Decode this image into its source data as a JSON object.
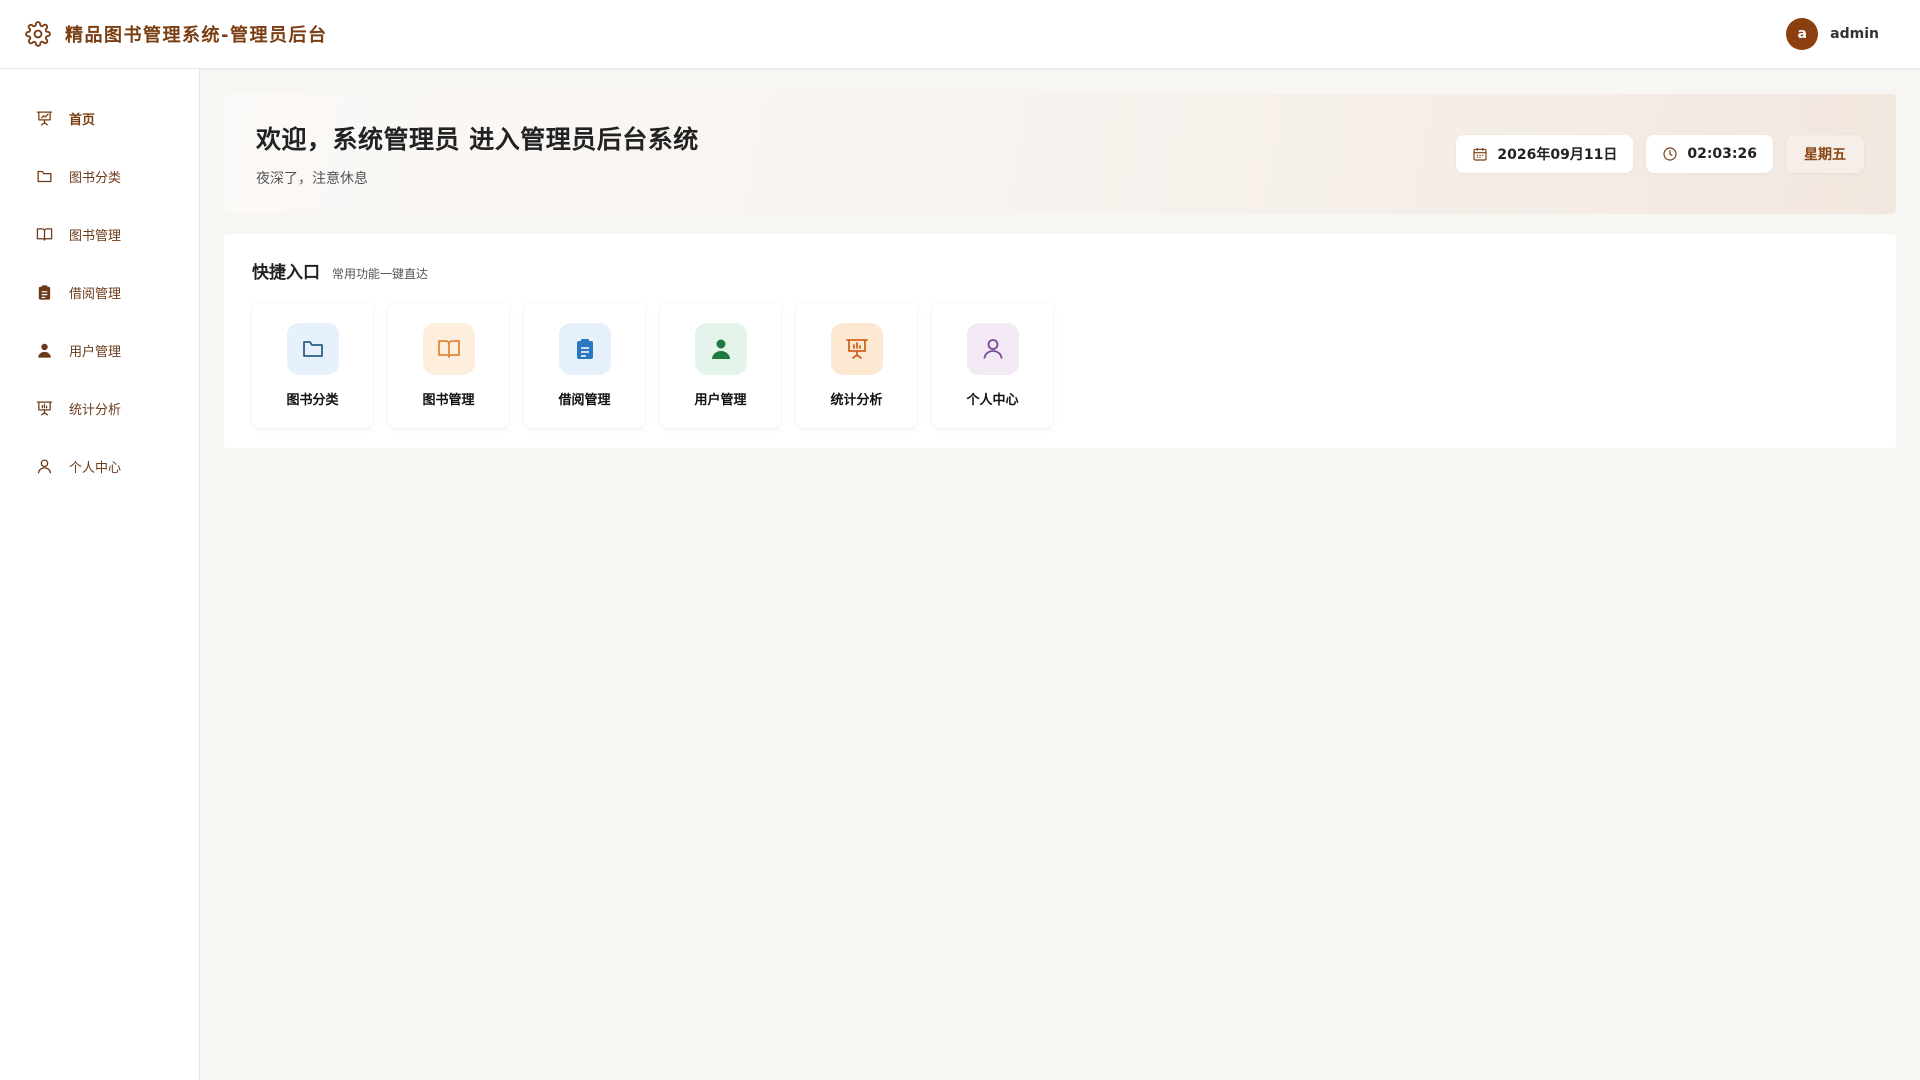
{
  "header": {
    "title": "精品图书管理系统-管理员后台",
    "avatar_letter": "a",
    "username": "admin"
  },
  "sidebar": {
    "items": [
      {
        "label": "首页",
        "icon": "presentation-icon",
        "active": true
      },
      {
        "label": "图书分类",
        "icon": "folder-icon"
      },
      {
        "label": "图书管理",
        "icon": "book-open-icon"
      },
      {
        "label": "借阅管理",
        "icon": "clipboard-icon"
      },
      {
        "label": "用户管理",
        "icon": "user-solid-icon"
      },
      {
        "label": "统计分析",
        "icon": "chart-board-icon"
      },
      {
        "label": "个人中心",
        "icon": "user-outline-icon"
      }
    ]
  },
  "welcome": {
    "title": "欢迎，系统管理员 进入管理员后台系统",
    "subtitle": "夜深了，注意休息",
    "date": "2026年09月11日",
    "time": "02:03:26",
    "weekday": "星期五"
  },
  "quick": {
    "title": "快捷入口",
    "subtitle": "常用功能一键直达",
    "cards": [
      {
        "label": "图书分类",
        "icon": "folder-icon",
        "bg": "#e7f1fb",
        "color": "#2b5f8a"
      },
      {
        "label": "图书管理",
        "icon": "book-open-icon",
        "bg": "#fdeedd",
        "color": "#e0883a"
      },
      {
        "label": "借阅管理",
        "icon": "clipboard-icon",
        "bg": "#e6f0fa",
        "color": "#2a78c0"
      },
      {
        "label": "用户管理",
        "icon": "user-solid-icon",
        "bg": "#e5f4ea",
        "color": "#1e7a3e"
      },
      {
        "label": "统计分析",
        "icon": "chart-board-icon",
        "bg": "#fde8d2",
        "color": "#d0631f"
      },
      {
        "label": "个人中心",
        "icon": "user-outline-icon",
        "bg": "#f2e9f5",
        "color": "#7b4a94"
      }
    ]
  },
  "colors": {
    "brand": "#7a3e12",
    "avatar": "#8b3f0e",
    "background": "#f8f6f3"
  }
}
